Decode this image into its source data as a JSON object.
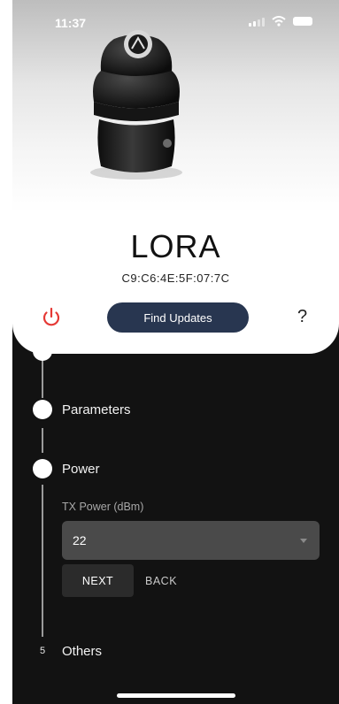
{
  "status_bar": {
    "time": "11:37"
  },
  "device": {
    "name": "LORA",
    "mac": "C9:C6:4E:5F:07:7C"
  },
  "actions": {
    "find_updates_label": "Find Updates",
    "help_label": "?"
  },
  "colors": {
    "power_icon": "#e53935",
    "update_button": "#283650",
    "background": "#121212"
  },
  "stepper": {
    "steps": [
      {
        "label": "Parameters"
      },
      {
        "label": "Power"
      },
      {
        "number": "5",
        "label": "Others"
      }
    ],
    "power": {
      "field_label": "TX Power (dBm)",
      "selected_value": "22",
      "next_label": "NEXT",
      "back_label": "BACK"
    }
  }
}
